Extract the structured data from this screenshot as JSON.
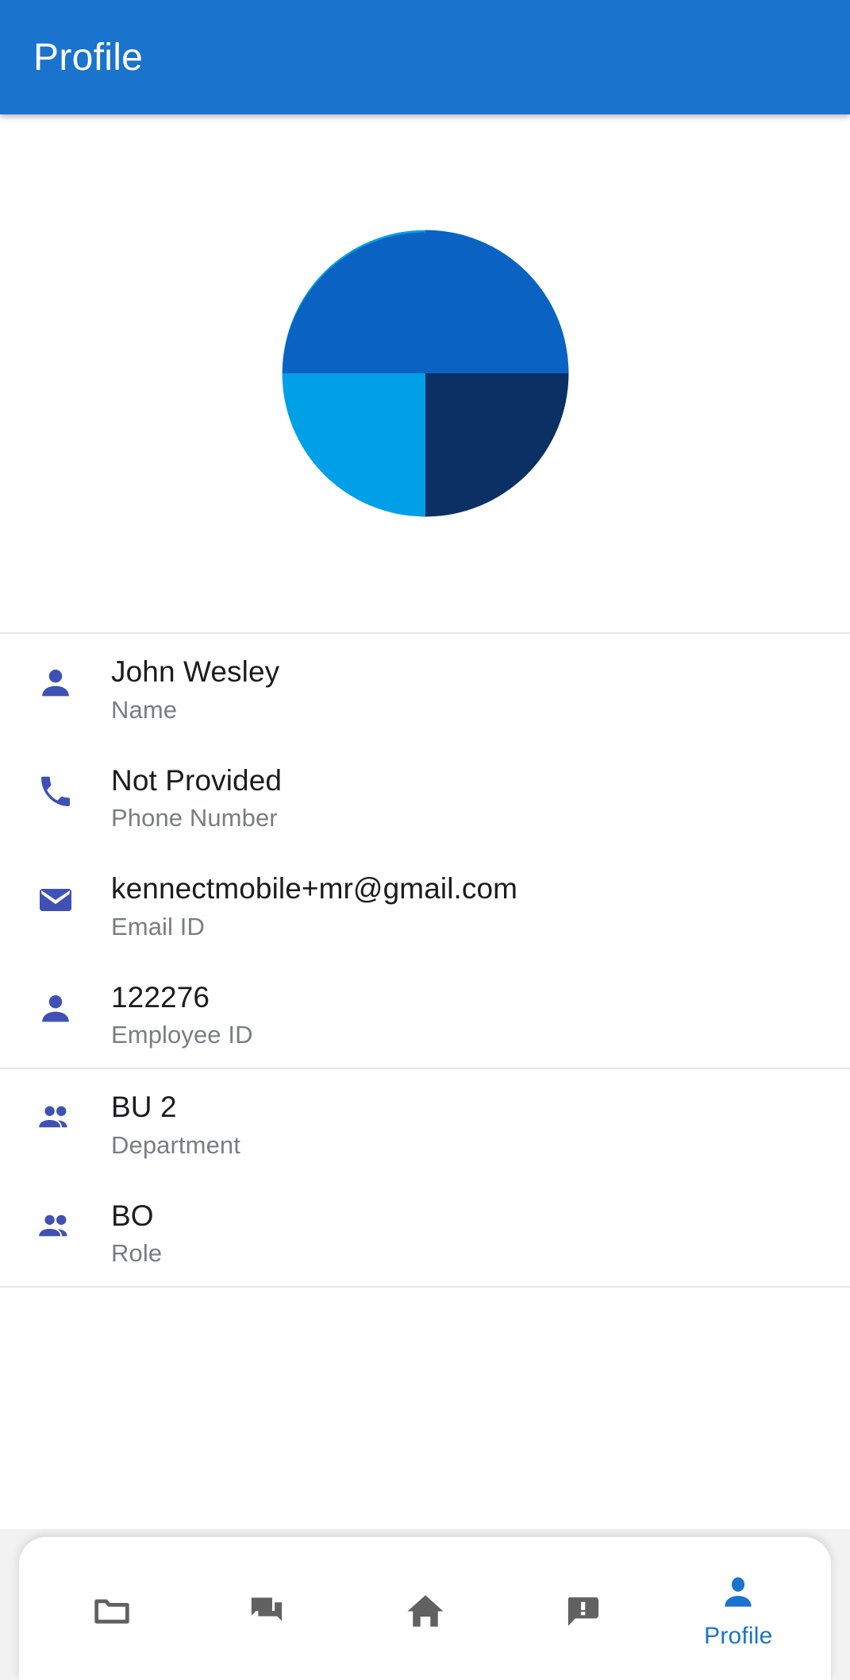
{
  "appbar": {
    "title": "Profile",
    "background_color": "#1a73cc",
    "title_color": "#ffffff"
  },
  "logo": {
    "name": "company-logo",
    "colors": {
      "light_blue": "#00a0e9",
      "mid_blue": "#0a63c2",
      "dark_navy": "#0b3064"
    }
  },
  "profile": {
    "icon_color": "#3f51b5",
    "rows": [
      {
        "icon": "person-icon",
        "value": "John Wesley",
        "label": "Name"
      },
      {
        "icon": "phone-icon",
        "value": "Not Provided",
        "label": "Phone Number"
      },
      {
        "icon": "email-icon",
        "value": "kennectmobile+mr@gmail.com",
        "label": "Email ID"
      },
      {
        "icon": "person-icon",
        "value": "122276",
        "label": "Employee ID"
      },
      {
        "icon": "group-icon",
        "value": "BU 2",
        "label": "Department"
      },
      {
        "icon": "group-icon",
        "value": "BO",
        "label": "Role"
      }
    ]
  },
  "bottom_nav": {
    "active_color": "#1a73cc",
    "inactive_color": "#616161",
    "items": [
      {
        "icon": "folder-icon",
        "label": "",
        "active": false
      },
      {
        "icon": "chat-icon",
        "label": "",
        "active": false
      },
      {
        "icon": "home-icon",
        "label": "",
        "active": false
      },
      {
        "icon": "announcement-icon",
        "label": "",
        "active": false
      },
      {
        "icon": "person-icon",
        "label": "Profile",
        "active": true
      }
    ]
  }
}
